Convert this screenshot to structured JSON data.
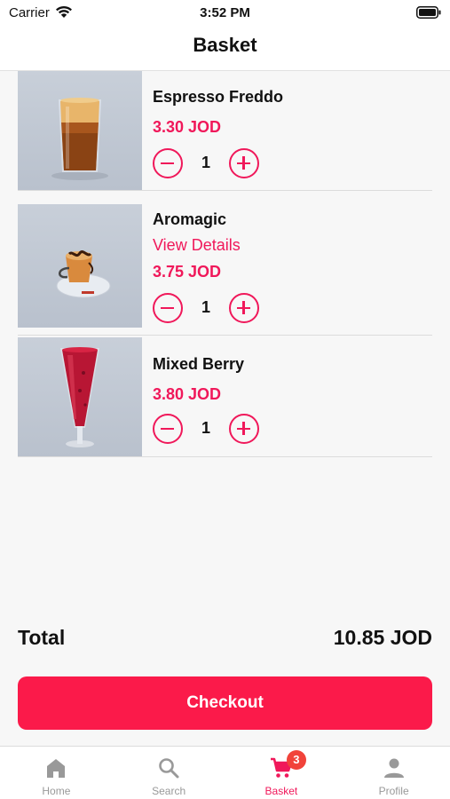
{
  "status_bar": {
    "carrier": "Carrier",
    "time": "3:52 PM"
  },
  "nav": {
    "title": "Basket"
  },
  "items": [
    {
      "name": "Espresso Freddo",
      "link": "",
      "price": "3.30 JOD",
      "quantity": "1",
      "image": "iced-coffee-glass"
    },
    {
      "name": "Aromagic",
      "link": "View Details",
      "price": "3.75 JOD",
      "quantity": "1",
      "image": "espresso-cup-on-saucer"
    },
    {
      "name": "Mixed Berry",
      "link": "",
      "price": "3.80 JOD",
      "quantity": "1",
      "image": "berry-smoothie-tall-glass"
    }
  ],
  "total": {
    "label": "Total",
    "value": "10.85 JOD"
  },
  "checkout": {
    "label": "Checkout"
  },
  "tabs": [
    {
      "label": "Home",
      "icon": "home-icon",
      "active": false
    },
    {
      "label": "Search",
      "icon": "search-icon",
      "active": false
    },
    {
      "label": "Basket",
      "icon": "cart-icon",
      "active": true,
      "badge": "3"
    },
    {
      "label": "Profile",
      "icon": "profile-icon",
      "active": false
    }
  ],
  "colors": {
    "accent": "#f0185a",
    "button": "#fb1a4a",
    "badge": "#f1433a",
    "inactive_tab": "#999999"
  }
}
